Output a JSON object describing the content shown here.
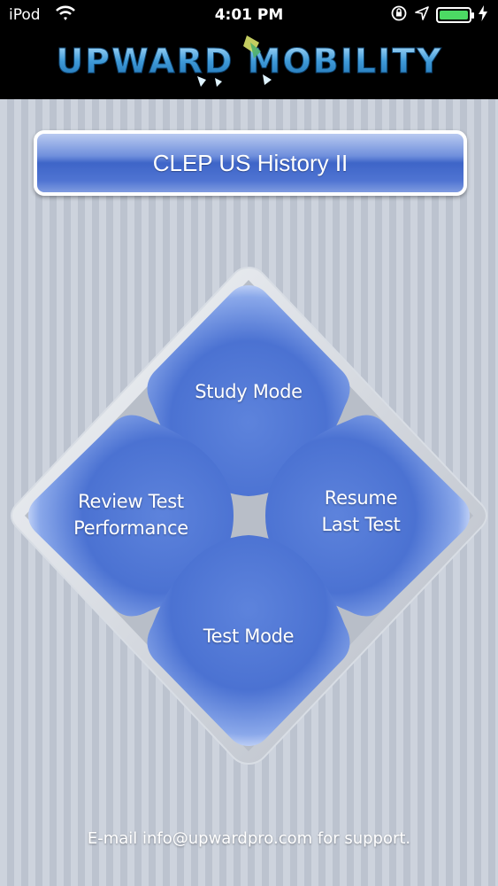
{
  "status_bar": {
    "carrier": "iPod",
    "time": "4:01 PM"
  },
  "header": {
    "logo_text": "UPWARD MOBILITY",
    "logo_colors": {
      "text": "#3f9ad8",
      "accent": "#8fd3ff"
    }
  },
  "title_button": {
    "label": "CLEP US History II"
  },
  "menu": {
    "study_mode": "Study Mode",
    "review_line1": "Review Test",
    "review_line2": "Performance",
    "resume_line1": "Resume",
    "resume_line2": "Last Test",
    "test_mode": "Test Mode"
  },
  "footer": {
    "support_text": "E-mail info@upwardpro.com for support."
  },
  "colors": {
    "button_blue": "#4a6fd0",
    "battery_green": "#4cd964",
    "background_stripe_light": "#cdd3dd",
    "background_stripe_dark": "#bcc3cf"
  }
}
